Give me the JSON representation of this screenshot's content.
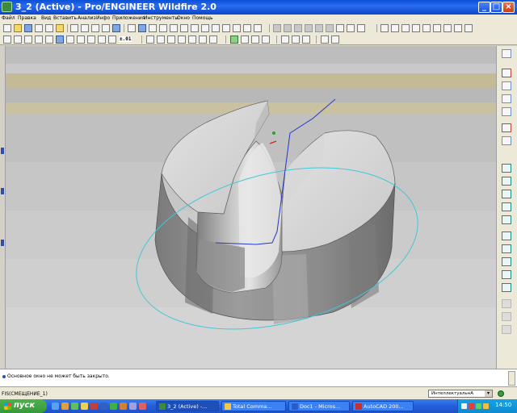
{
  "window": {
    "title": "3_2 (Active) - Pro/ENGINEER Wildfire 2.0",
    "minimize": "_",
    "maximize": "□",
    "close": "×"
  },
  "menu": [
    "Файл",
    "Правка",
    "Вид",
    "Вставить",
    "Анализ",
    "Инфо",
    "Приложения",
    "Инструменты",
    "Окно",
    "Помощь"
  ],
  "toolbar": {
    "ratio_label": "±.01"
  },
  "messages": {
    "line1": "Основное окно не может быть закрыто."
  },
  "status": {
    "text": "FIS(СМЕЩЕНИЕ_1)",
    "filter_value": "ИнтеллектуальнА",
    "filter_arrow": "▾"
  },
  "taskbar": {
    "start_label": "пуск",
    "tasks": [
      {
        "label": "3_2 (Active) -...",
        "active": true,
        "icon_color": "#3c8a3c"
      },
      {
        "label": "Total Comma...",
        "active": false,
        "icon_color": "#f2c84a"
      },
      {
        "label": "Doc1 - Micros...",
        "active": false,
        "icon_color": "#2a5cc8"
      },
      {
        "label": "AutoCAD 200...",
        "active": false,
        "icon_color": "#c83030"
      }
    ],
    "clock": "14:50"
  },
  "colors": {
    "title_bar": "#0a4fd8",
    "viewport_band_tan": "#c4bb96",
    "viewport_gray": "#c8c8c8",
    "curve_cyan": "#40c8d8",
    "curve_blue": "#2438c8"
  }
}
